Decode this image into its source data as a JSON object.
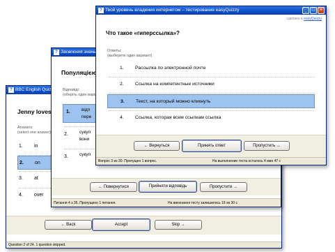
{
  "win1": {
    "title": "BBC English Quiz – ...",
    "question": "Jenny loves s",
    "answers_label": "Answers:",
    "answers_hint": "(select one answer)",
    "options": [
      {
        "num": "1.",
        "text": "in"
      },
      {
        "num": "2.",
        "text": "on"
      },
      {
        "num": "3.",
        "text": "at"
      },
      {
        "num": "4.",
        "text": "over"
      }
    ],
    "selected_index": 1,
    "back_label": "← Back",
    "accept_label": "Accept",
    "skip_label": "Skip →",
    "status": "Question 2 of 24. 1 question skipped."
  },
  "win2": {
    "title": "Засвоєння знань ...",
    "question": "Популяцією н",
    "answers_label": "Відповіді:",
    "answers_hint": "(оберіть один варіант)",
    "options": [
      {
        "num": "1.",
        "text": "відп",
        "text2": "пере"
      },
      {
        "num": "2.",
        "text": "сукуп",
        "text2": "вони"
      },
      {
        "num": "3.",
        "text": "сукуп",
        "text2": ""
      }
    ],
    "selected_index": 0,
    "back_label": "← Повернутися",
    "accept_label": "Прийняти відповідь",
    "skip_label": "Пропустити →",
    "status_left": "Питання 4 з 35. Пропущено 1 питання.",
    "status_right": "На виконання тесту залишилось 19 хв 30 с"
  },
  "win3": {
    "title": "Твой уровень владения интернетом – тестирование easyQuizzy",
    "made_in": "сделано в",
    "made_in_link": "easyQuizzy",
    "question": "Что такое «гиперссылка»?",
    "answers_label": "Ответы:",
    "answers_hint": "(выберите один вариант)",
    "options": [
      {
        "num": "1.",
        "text": "Рассылка по электронной почте"
      },
      {
        "num": "2.",
        "text": "Ссылка на компетентные источники"
      },
      {
        "num": "3.",
        "text": "Текст, на который можно кликнуть"
      },
      {
        "num": "4.",
        "text": "Ссылка, которая всем ссылкам ссылка"
      }
    ],
    "selected_index": 2,
    "back_label": "← Вернуться",
    "accept_label": "Принять ответ",
    "skip_label": "Пропустить →",
    "status_left": "Вопрос 3 из 30. Пропущен 1 вопрос.",
    "status_right": "На выполнение теста осталось 4 мин 47 с"
  },
  "colors": {
    "titlebar": "#0e4fc8",
    "selected": "#9fc3ef",
    "btnbar": "#f1efe2"
  }
}
